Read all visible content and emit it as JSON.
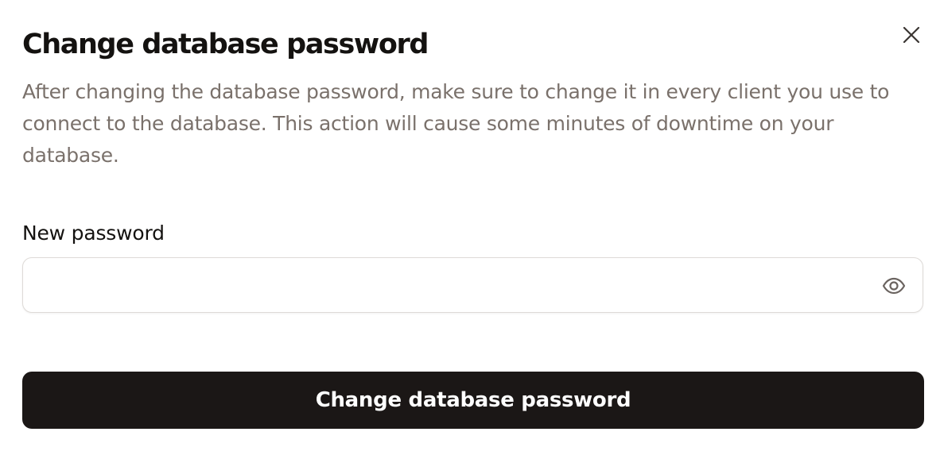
{
  "dialog": {
    "title": "Change database password",
    "description": "After changing the database password, make sure to change it in every client you use to connect to the database. This action will cause some minutes of downtime on your database.",
    "close_icon": "close-icon"
  },
  "form": {
    "password_label": "New password",
    "password_value": "",
    "password_placeholder": "",
    "visibility_icon": "eye-icon"
  },
  "actions": {
    "submit_label": "Change database password"
  },
  "colors": {
    "primary_button": "#1b1716",
    "description_text": "#7a716b",
    "heading_text": "#141210",
    "input_border": "#dedad7"
  }
}
